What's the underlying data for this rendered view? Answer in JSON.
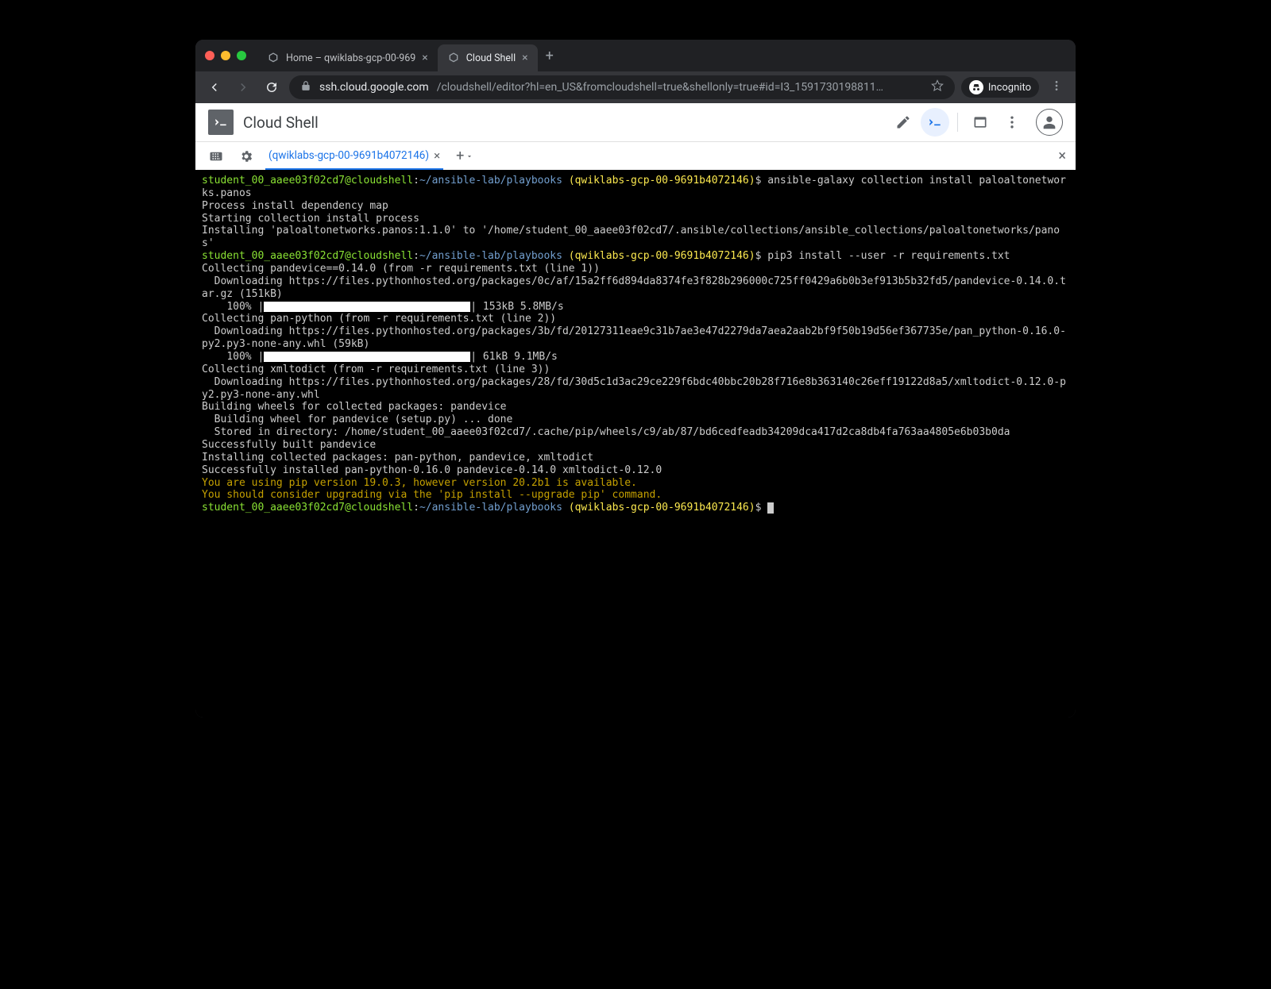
{
  "browser": {
    "tabs": [
      {
        "title": "Home – qwiklabs-gcp-00-969",
        "active": false
      },
      {
        "title": "Cloud Shell",
        "active": true
      }
    ],
    "url_host": "ssh.cloud.google.com",
    "url_path": "/cloudshell/editor?hl=en_US&fromcloudshell=true&shellonly=true#id=I3_1591730198811…",
    "incognito_label": "Incognito"
  },
  "app": {
    "title": "Cloud Shell",
    "shell_tab": "(qwiklabs-gcp-00-9691b4072146)"
  },
  "term": {
    "user": "student_00_aaee03f02cd7@cloudshell",
    "path": "~/ansible-lab/playbooks",
    "project": "(qwiklabs-gcp-00-9691b4072146)",
    "cmd1": "ansible-galaxy collection install paloaltonetworks.panos",
    "l1": "Process install dependency map",
    "l2": "Starting collection install process",
    "l3": "Installing 'paloaltonetworks.panos:1.1.0' to '/home/student_00_aaee03f02cd7/.ansible/collections/ansible_collections/paloaltonetworks/panos'",
    "cmd2": "pip3 install --user -r requirements.txt",
    "c1": "Collecting pandevice==0.14.0 (from -r requirements.txt (line 1))",
    "d1": "  Downloading https://files.pythonhosted.org/packages/0c/af/15a2ff6d894da8374fe3f828b296000c725ff0429a6b0b3ef913b5b32fd5/pandevice-0.14.0.tar.gz (151kB)",
    "p1a": "    100% |",
    "p1b": "| 153kB 5.8MB/s",
    "c2": "Collecting pan-python (from -r requirements.txt (line 2))",
    "d2": "  Downloading https://files.pythonhosted.org/packages/3b/fd/20127311eae9c31b7ae3e47d2279da7aea2aab2bf9f50b19d56ef367735e/pan_python-0.16.0-py2.py3-none-any.whl (59kB)",
    "p2a": "    100% |",
    "p2b": "| 61kB 9.1MB/s",
    "c3": "Collecting xmltodict (from -r requirements.txt (line 3))",
    "d3": "  Downloading https://files.pythonhosted.org/packages/28/fd/30d5c1d3ac29ce229f6bdc40bbc20b28f716e8b363140c26eff19122d8a5/xmltodict-0.12.0-py2.py3-none-any.whl",
    "b1": "Building wheels for collected packages: pandevice",
    "b2": "  Building wheel for pandevice (setup.py) ... done",
    "b3": "  Stored in directory: /home/student_00_aaee03f02cd7/.cache/pip/wheels/c9/ab/87/bd6cedfeadb34209dca417d2ca8db4fa763aa4805e6b03b0da",
    "b4": "Successfully built pandevice",
    "i1": "Installing collected packages: pan-python, pandevice, xmltodict",
    "i2": "Successfully installed pan-python-0.16.0 pandevice-0.14.0 xmltodict-0.12.0",
    "w1": "You are using pip version 19.0.3, however version 20.2b1 is available.",
    "w2": "You should consider upgrading via the 'pip install --upgrade pip' command."
  }
}
